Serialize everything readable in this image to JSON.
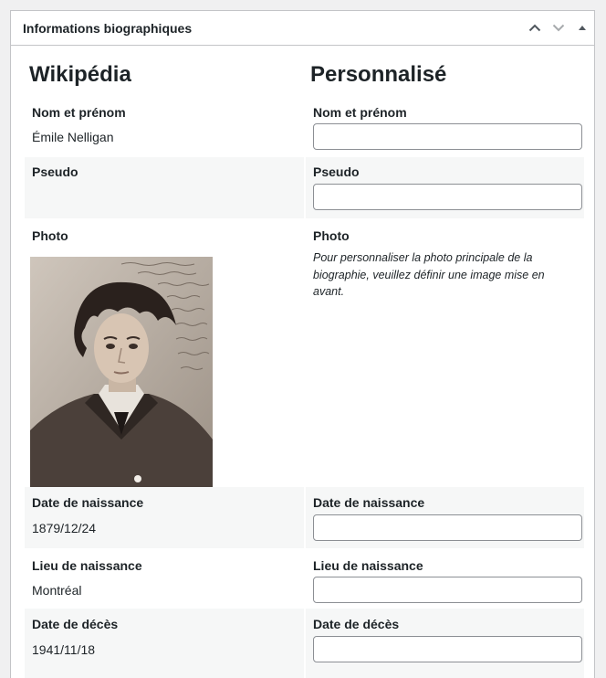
{
  "panel": {
    "title": "Informations biographiques",
    "move_up_icon": "chevron-up",
    "move_down_icon": "chevron-down",
    "toggle_icon": "triangle-up"
  },
  "columns": {
    "left": "Wikipédia",
    "right": "Personnalisé"
  },
  "fields": {
    "name": {
      "label": "Nom et prénom",
      "wiki_value": "Émile Nelligan",
      "custom_value": ""
    },
    "pseudo": {
      "label": "Pseudo",
      "wiki_value": "",
      "custom_value": ""
    },
    "photo": {
      "label": "Photo",
      "note": "Pour personnaliser la photo principale de la biographie, veuillez définir une image mise en avant."
    },
    "birth_date": {
      "label": "Date de naissance",
      "wiki_value": "1879/12/24",
      "custom_value": ""
    },
    "birth_place": {
      "label": "Lieu de naissance",
      "wiki_value": "Montréal",
      "custom_value": ""
    },
    "death_date": {
      "label": "Date de décès",
      "wiki_value": "1941/11/18",
      "custom_value": ""
    }
  }
}
